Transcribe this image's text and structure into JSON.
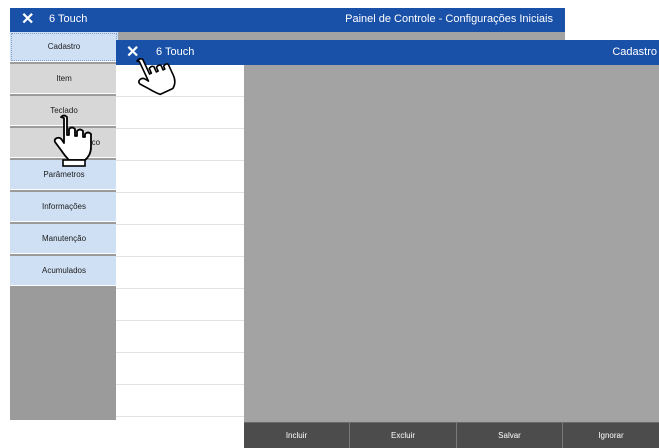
{
  "back_window": {
    "close_icon": "close-icon",
    "app_name": "6 Touch",
    "title": "Painel de Controle - Configurações Iniciais",
    "sidebar": [
      {
        "label": "Cadastro",
        "style": "active"
      },
      {
        "label": "Item",
        "style": "gray"
      },
      {
        "label": "Teclado",
        "style": "gray"
      },
      {
        "label": "Numérico",
        "style": "gray"
      },
      {
        "label": "Parâmetros",
        "style": "blue"
      },
      {
        "label": "Informações",
        "style": "blue"
      },
      {
        "label": "Manutenção",
        "style": "blue"
      },
      {
        "label": "Acumulados",
        "style": "blue"
      }
    ]
  },
  "front_window": {
    "close_icon": "close-icon",
    "app_name": "6 Touch",
    "title": "Cadastro",
    "toolbar": {
      "incluir": "Incluir",
      "excluir": "Excluir",
      "salvar": "Salvar",
      "ignorar": "Ignorar"
    }
  },
  "colors": {
    "titlebar": "#1a51a8",
    "sidebar_blue": "#cfe0f4",
    "sidebar_gray": "#d7d7d7",
    "content_gray": "#a3a3a3",
    "toolbar": "#4a4a4a"
  },
  "cursors": [
    "hand-pointer-icon",
    "hand-pointer-icon"
  ]
}
